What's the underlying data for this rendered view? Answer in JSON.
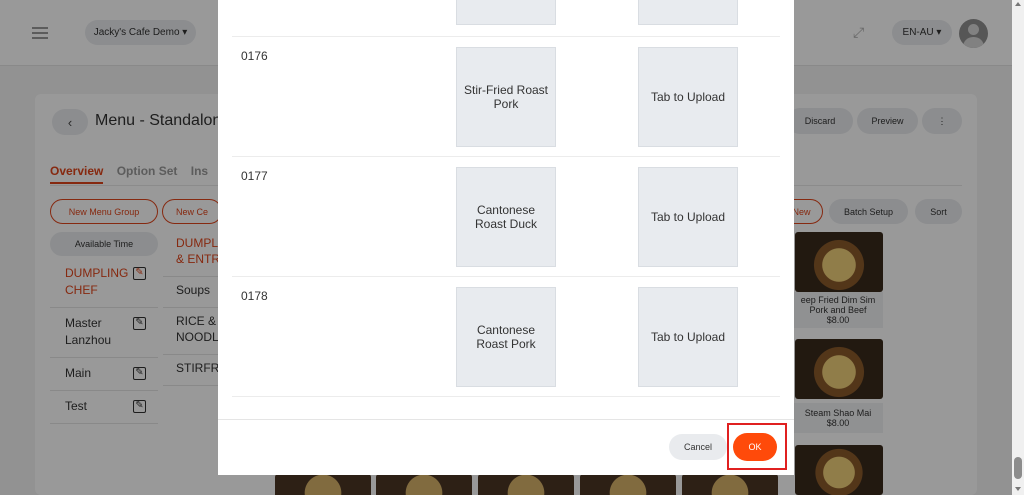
{
  "header": {
    "store_selector": "Jacky's Cafe Demo ▾",
    "language_selector": "EN-AU ▾"
  },
  "page": {
    "back_label": "‹",
    "title": "Menu - Standalon",
    "actions": {
      "discard": "Discard",
      "preview": "Preview",
      "more": "⋮"
    },
    "tabs": [
      "Overview",
      "Option Set",
      "Ins"
    ],
    "buttons": {
      "new_menu_group": "New Menu Group",
      "new_category": "New Ce",
      "new_item": "New",
      "batch_setup": "Batch Setup",
      "sort": "Sort",
      "available_time": "Available Time"
    },
    "menu_groups": [
      "DUMPLING CHEF",
      "Master Lanzhou",
      "Main",
      "Test"
    ],
    "categories": [
      "DUMPLI & ENTR",
      "Soups",
      "RICE & NOODL",
      "STIRFR"
    ],
    "dishes": [
      {
        "name": "eep Fried Dim Sim Pork and Beef",
        "price": "$8.00"
      },
      {
        "name": "Steam Shao Mai",
        "price": "$8.00"
      }
    ]
  },
  "modal": {
    "rows": [
      {
        "code": "0176",
        "name": "Stir-Fried Roast Pork",
        "upload": "Tab to Upload"
      },
      {
        "code": "0177",
        "name": "Cantonese Roast Duck",
        "upload": "Tab to Upload"
      },
      {
        "code": "0178",
        "name": "Cantonese Roast Pork",
        "upload": "Tab to Upload"
      }
    ],
    "cancel_label": "Cancel",
    "ok_label": "OK"
  },
  "icons": {
    "menu": "hamburger-icon",
    "fullscreen": "expand-icon",
    "user": "avatar-icon",
    "edit": "edit-icon"
  },
  "colors": {
    "accent": "#e0451b",
    "ok_button": "#ff4a0a",
    "highlight": "#e02020"
  }
}
